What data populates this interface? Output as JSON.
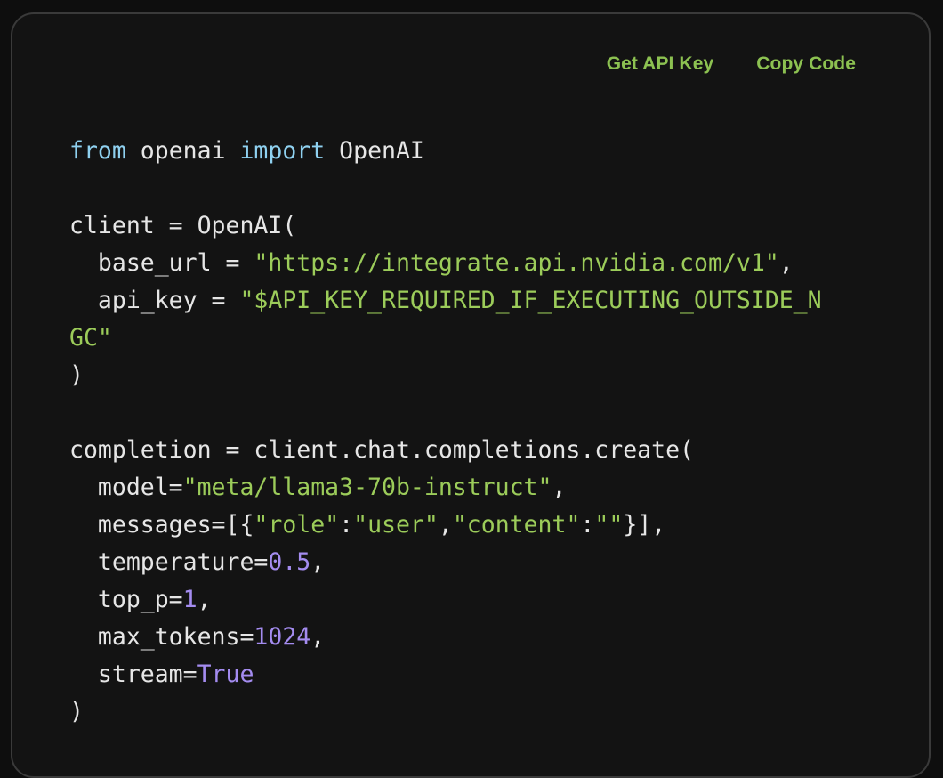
{
  "toolbar": {
    "get_api_key_label": "Get API Key",
    "copy_code_label": "Copy Code"
  },
  "colors": {
    "background": "#131313",
    "keyword": "#8fd1f0",
    "string": "#9ccc5a",
    "number": "#a48cf0",
    "accent": "#8cc151",
    "text": "#e6e6e6"
  },
  "code_lines": [
    [
      {
        "t": "from",
        "c": "kw"
      },
      {
        "t": " openai "
      },
      {
        "t": "import",
        "c": "kw"
      },
      {
        "t": " OpenAI"
      }
    ],
    [],
    [
      {
        "t": "client = OpenAI("
      }
    ],
    [
      {
        "t": "  base_url = "
      },
      {
        "t": "\"https://integrate.api.nvidia.com/v1\"",
        "c": "str"
      },
      {
        "t": ","
      }
    ],
    [
      {
        "t": "  api_key = "
      },
      {
        "t": "\"$API_KEY_REQUIRED_IF_EXECUTING_OUTSIDE_N",
        "c": "str"
      }
    ],
    [
      {
        "t": "GC\"",
        "c": "str"
      }
    ],
    [
      {
        "t": ")"
      }
    ],
    [],
    [
      {
        "t": "completion = client.chat.completions.create("
      }
    ],
    [
      {
        "t": "  model="
      },
      {
        "t": "\"meta/llama3-70b-instruct\"",
        "c": "str"
      },
      {
        "t": ","
      }
    ],
    [
      {
        "t": "  messages=[{"
      },
      {
        "t": "\"role\"",
        "c": "str"
      },
      {
        "t": ":"
      },
      {
        "t": "\"user\"",
        "c": "str"
      },
      {
        "t": ","
      },
      {
        "t": "\"content\"",
        "c": "str"
      },
      {
        "t": ":"
      },
      {
        "t": "\"\"",
        "c": "str"
      },
      {
        "t": "}],"
      }
    ],
    [
      {
        "t": "  temperature="
      },
      {
        "t": "0.5",
        "c": "num"
      },
      {
        "t": ","
      }
    ],
    [
      {
        "t": "  top_p="
      },
      {
        "t": "1",
        "c": "num"
      },
      {
        "t": ","
      }
    ],
    [
      {
        "t": "  max_tokens="
      },
      {
        "t": "1024",
        "c": "num"
      },
      {
        "t": ","
      }
    ],
    [
      {
        "t": "  stream="
      },
      {
        "t": "True",
        "c": "num"
      }
    ],
    [
      {
        "t": ")"
      }
    ]
  ]
}
